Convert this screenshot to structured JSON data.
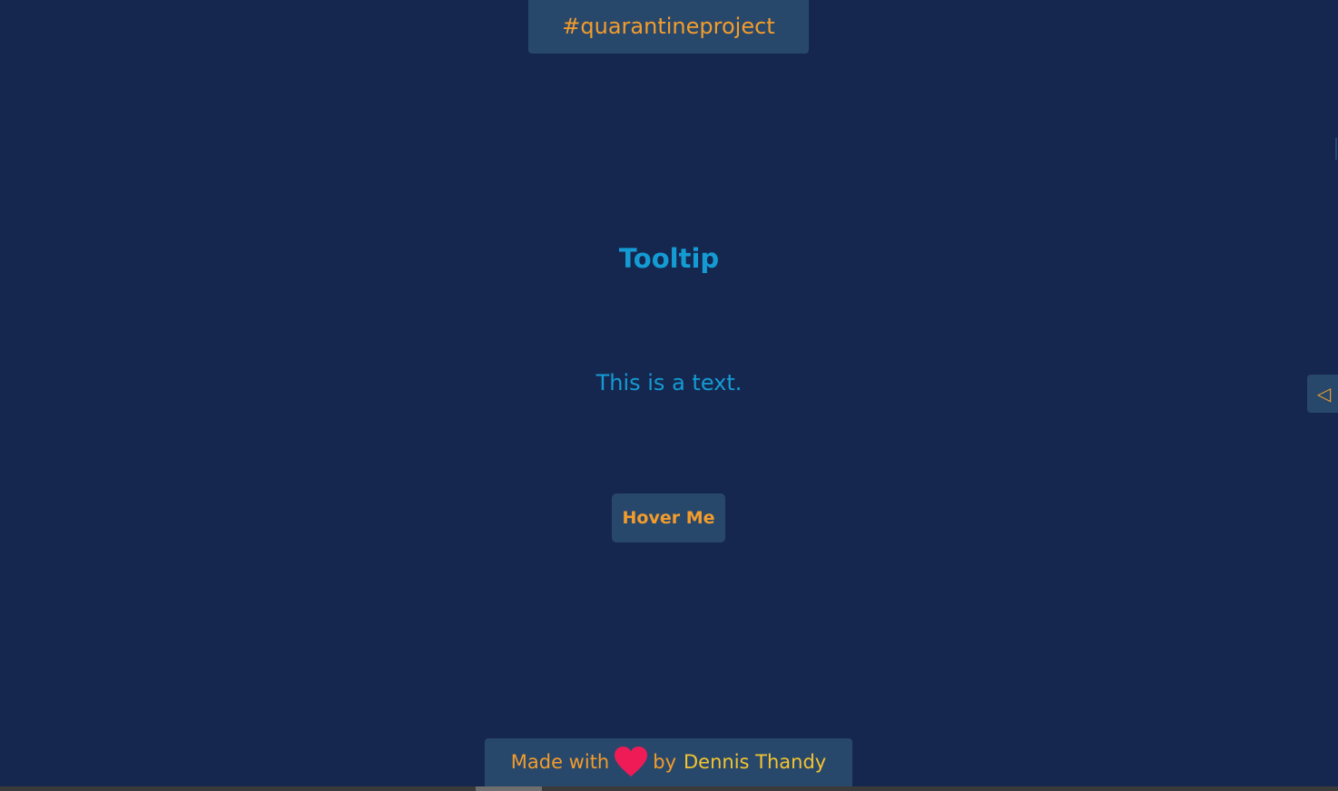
{
  "header": {
    "badge_text": "#quarantineproject"
  },
  "main": {
    "title": "Tooltip",
    "text": "This is a text.",
    "button_label": "Hover Me"
  },
  "side_toggle": {
    "glyph": "◁",
    "icon": "triangle-left-icon"
  },
  "footer": {
    "made_with": "Made with",
    "by": "by",
    "author": "Dennis Thandy",
    "icon": "heart-icon"
  },
  "colors": {
    "background": "#16274f",
    "panel": "#28486b",
    "accent_orange": "#f39c2c",
    "accent_blue": "#149bd3",
    "heart": "#ee1b57",
    "author_yellow": "#f4c430"
  }
}
